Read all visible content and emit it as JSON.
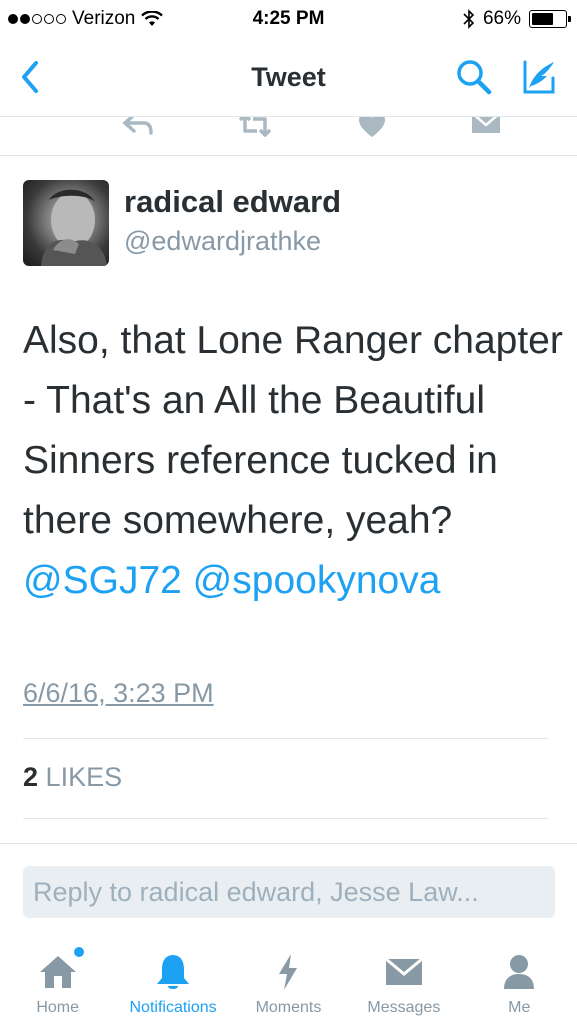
{
  "status_bar": {
    "carrier": "Verizon",
    "time": "4:25 PM",
    "battery": "66%",
    "battery_level": 0.66,
    "signal_bars": 2
  },
  "nav": {
    "title": "Tweet"
  },
  "tweet": {
    "display_name": "radical edward",
    "handle": "@edwardjrathke",
    "text": "Also, that Lone Ranger chapter - That's an All the Beautiful Sinners reference tucked in there somewhere, yeah?",
    "mentions": [
      "@SGJ72",
      "@spookynova"
    ],
    "timestamp": "6/6/16, 3:23 PM",
    "likes_count": "2",
    "likes_label": "LIKES"
  },
  "reply": {
    "placeholder": "Reply to radical edward, Jesse Law..."
  },
  "tabs": [
    {
      "label": "Home",
      "icon": "home-icon"
    },
    {
      "label": "Notifications",
      "icon": "bell-icon"
    },
    {
      "label": "Moments",
      "icon": "lightning-icon"
    },
    {
      "label": "Messages",
      "icon": "envelope-icon"
    },
    {
      "label": "Me",
      "icon": "person-icon"
    }
  ],
  "colors": {
    "accent": "#1da1f2",
    "muted": "#8899a6",
    "text": "#292f33"
  }
}
